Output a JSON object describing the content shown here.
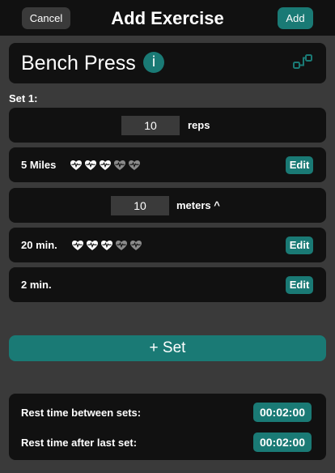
{
  "header": {
    "cancel_label": "Cancel",
    "title": "Add Exercise",
    "add_label": "Add"
  },
  "exercise": {
    "name": "Bench Press",
    "info_icon": "info-icon",
    "reorder_icon": "reorder-icon"
  },
  "set": {
    "label": "Set 1:",
    "rows": [
      {
        "type": "input",
        "value": "10",
        "unit": "reps"
      },
      {
        "type": "activity",
        "text": "5 Miles",
        "hearts_filled": 3,
        "hearts_total": 5,
        "edit_label": "Edit"
      },
      {
        "type": "input",
        "value": "10",
        "unit": "meters ^"
      },
      {
        "type": "activity",
        "text": "20 min.",
        "hearts_filled": 3,
        "hearts_total": 5,
        "edit_label": "Edit"
      },
      {
        "type": "activity",
        "text": "2 min.",
        "edit_label": "Edit"
      }
    ]
  },
  "add_set_label": "+ Set",
  "rest": {
    "between_label": "Rest time between sets:",
    "between_value": "00:02:00",
    "after_label": "Rest time after last set:",
    "after_value": "00:02:00"
  },
  "colors": {
    "accent": "#1a7a75",
    "background": "#3a3a3a",
    "card": "#111111",
    "heart_filled": "#ffffff",
    "heart_empty": "#8a8a8a"
  }
}
